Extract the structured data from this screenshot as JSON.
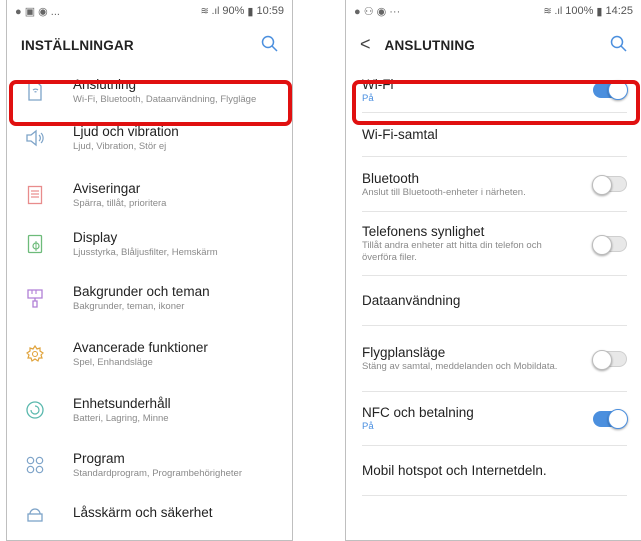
{
  "left_screen": {
    "statusbar": {
      "left_icons": "● ▣ ◉ ...",
      "signal": "≋ .ıl",
      "battery": "90%",
      "time": "10:59"
    },
    "title": "INSTÄLLNINGAR",
    "items": [
      {
        "icon": "connection-icon",
        "title": "Anslutning",
        "subtitle": "Wi-Fi, Bluetooth, Dataanvändning, Flygläge"
      },
      {
        "icon": "sound-icon",
        "title": "Ljud och vibration",
        "subtitle": "Ljud, Vibration, Stör ej"
      },
      {
        "icon": "notifications-icon",
        "title": "Aviseringar",
        "subtitle": "Spärra, tillåt, prioritera"
      },
      {
        "icon": "display-icon",
        "title": "Display",
        "subtitle": "Ljusstyrka, Blåljusfilter, Hemskärm"
      },
      {
        "icon": "wallpaper-icon",
        "title": "Bakgrunder och teman",
        "subtitle": "Bakgrunder, teman, ikoner"
      },
      {
        "icon": "advanced-features-icon",
        "title": "Avancerade funktioner",
        "subtitle": "Spel, Enhandsläge"
      },
      {
        "icon": "device-maintenance-icon",
        "title": "Enhetsunderhåll",
        "subtitle": "Batteri, Lagring, Minne"
      },
      {
        "icon": "apps-icon",
        "title": "Program",
        "subtitle": "Standardprogram, Programbehörigheter"
      },
      {
        "icon": "lock-screen-icon",
        "title": "Låsskärm och säkerhet",
        "subtitle": ""
      }
    ]
  },
  "right_screen": {
    "statusbar": {
      "left_icons": "● ⚇ ◉ ···",
      "signal": "≋ .ıl",
      "battery": "100%",
      "time": "14:25"
    },
    "title": "ANSLUTNING",
    "rows": [
      {
        "title": "Wi-Fi",
        "subtitle": "På",
        "toggle": "on"
      },
      {
        "title": "Wi-Fi-samtal",
        "subtitle": "",
        "toggle": "none"
      },
      {
        "title": "Bluetooth",
        "subtitle": "Anslut till Bluetooth-enheter i närheten.",
        "toggle": "off"
      },
      {
        "title": "Telefonens synlighet",
        "subtitle": "Tillåt andra enheter att hitta din telefon och överföra filer.",
        "toggle": "off"
      },
      {
        "title": "Dataanvändning",
        "subtitle": "",
        "toggle": "none"
      },
      {
        "title": "Flygplansläge",
        "subtitle": "Stäng av samtal, meddelanden och Mobildata.",
        "toggle": "off"
      },
      {
        "title": "NFC och betalning",
        "subtitle": "På",
        "toggle": "on"
      },
      {
        "title": "Mobil hotspot och Internetdeln.",
        "subtitle": "",
        "toggle": "none"
      }
    ]
  },
  "colors": {
    "accent": "#4b8fde",
    "highlight": "#e01010",
    "icon": "#7da3c8"
  }
}
